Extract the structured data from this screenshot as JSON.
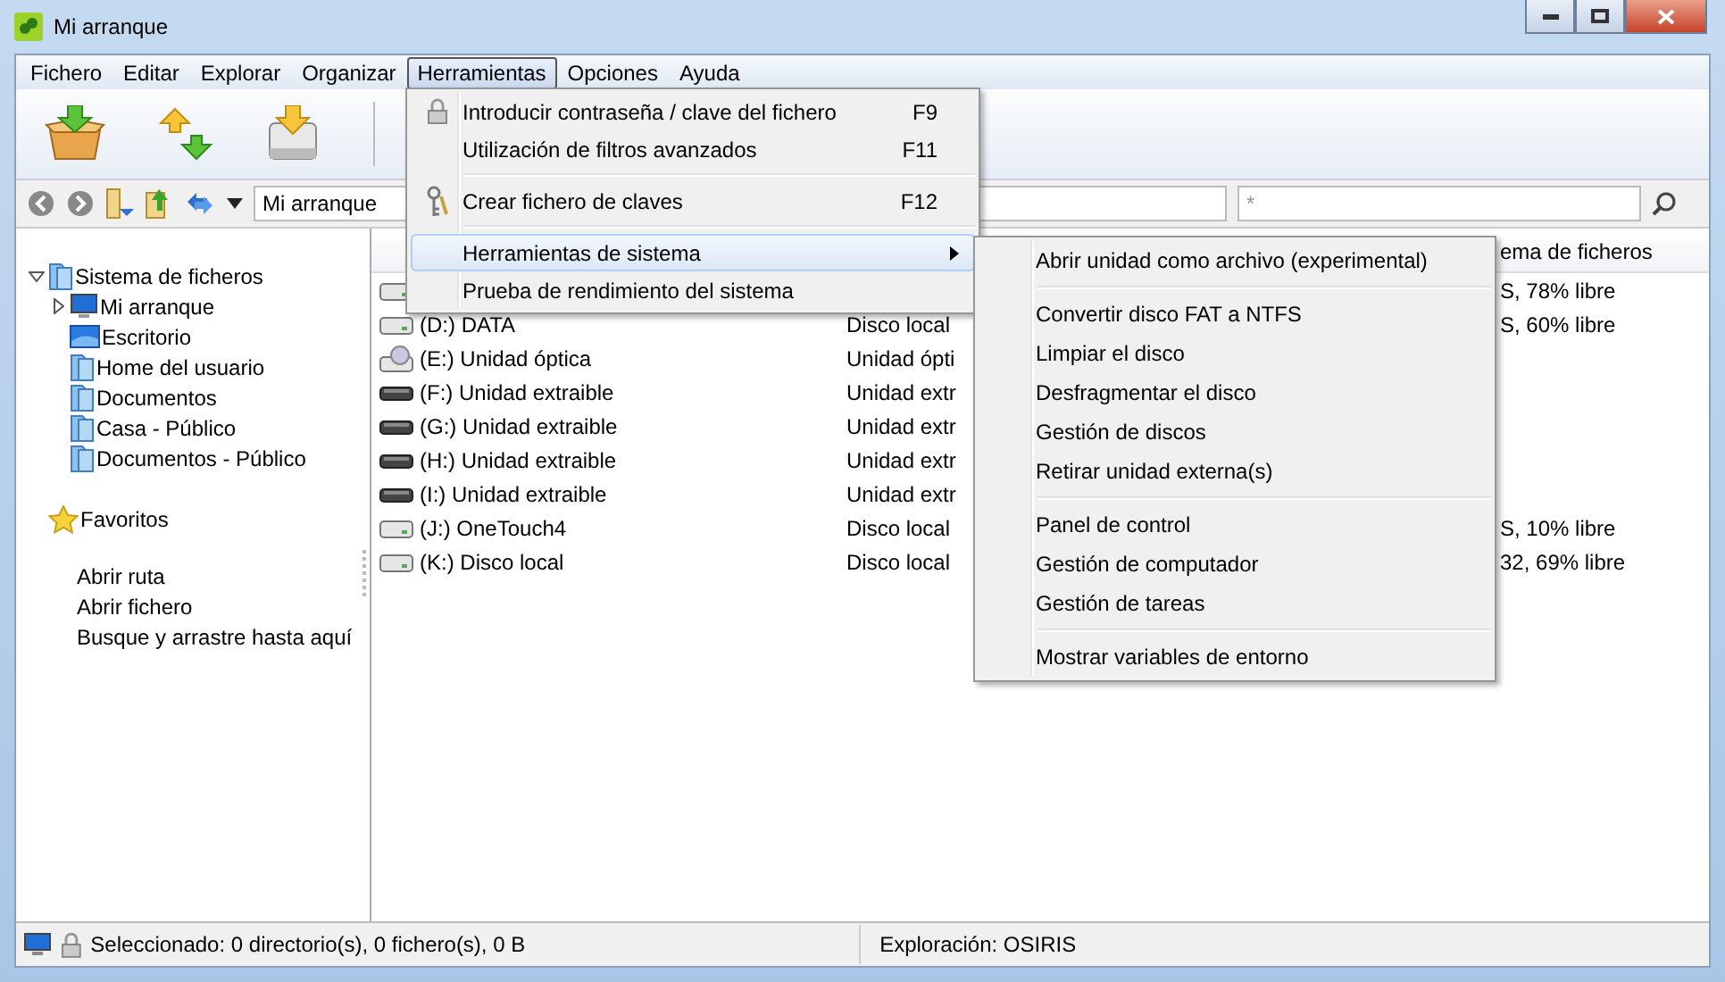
{
  "window": {
    "title": "Mi arranque"
  },
  "menu_bar": [
    {
      "label": "Fichero",
      "selected": false
    },
    {
      "label": "Editar",
      "selected": false
    },
    {
      "label": "Explorar",
      "selected": false
    },
    {
      "label": "Organizar",
      "selected": false
    },
    {
      "label": "Herramientas",
      "selected": true
    },
    {
      "label": "Opciones",
      "selected": false
    },
    {
      "label": "Ayuda",
      "selected": false
    }
  ],
  "address": {
    "value": "Mi arranque"
  },
  "search": {
    "placeholder": "*"
  },
  "tree": [
    {
      "label": "Sistema de ficheros",
      "kind": "folder",
      "expanded": true,
      "children": [
        {
          "label": "Mi arranque",
          "kind": "computer",
          "expanded": false
        },
        {
          "label": "Escritorio",
          "kind": "desktop"
        },
        {
          "label": "Home del usuario",
          "kind": "folder"
        },
        {
          "label": "Documentos",
          "kind": "folder"
        },
        {
          "label": "Casa - Público",
          "kind": "folder"
        },
        {
          "label": "Documentos - Público",
          "kind": "folder"
        }
      ]
    }
  ],
  "favorites": {
    "label": "Favoritos"
  },
  "links": [
    "Abrir ruta",
    "Abrir fichero",
    "Busque y arrastre hasta aquí"
  ],
  "file_list": {
    "column_3": "ema de ficheros",
    "rows": [
      {
        "kind": "disk",
        "filesystem": "S, 78% libre"
      },
      {
        "kind": "disk",
        "name": "(D:) DATA",
        "type": "Disco local",
        "filesystem": "S, 60% libre"
      },
      {
        "kind": "optical",
        "name": "(E:) Unidad óptica",
        "type": "Unidad ópti"
      },
      {
        "kind": "removable",
        "name": "(F:) Unidad extraible",
        "type": "Unidad extr"
      },
      {
        "kind": "removable",
        "name": "(G:) Unidad extraible",
        "type": "Unidad extr"
      },
      {
        "kind": "removable",
        "name": "(H:) Unidad extraible",
        "type": "Unidad extr"
      },
      {
        "kind": "removable",
        "name": "(I:) Unidad extraible",
        "type": "Unidad extr"
      },
      {
        "kind": "disk",
        "name": "(J:) OneTouch4",
        "type": "Disco local",
        "filesystem": "S, 10% libre"
      },
      {
        "kind": "disk",
        "name": "(K:) Disco local",
        "type": "Disco local",
        "filesystem": "32, 69% libre"
      }
    ]
  },
  "dropdown": {
    "items": [
      {
        "kind": "item",
        "label": "Introducir contraseña / clave del fichero",
        "shortcut": "F9",
        "highlighted": false
      },
      {
        "kind": "item",
        "label": "Utilización de filtros avanzados",
        "shortcut": "F11",
        "highlighted": false
      },
      {
        "kind": "separator"
      },
      {
        "kind": "item",
        "label": "Crear fichero de claves",
        "shortcut": "F12",
        "highlighted": false
      },
      {
        "kind": "separator"
      },
      {
        "kind": "submenu",
        "label": "Herramientas de sistema",
        "highlighted": true
      },
      {
        "kind": "item",
        "label": "Prueba de rendimiento del sistema",
        "highlighted": false
      }
    ]
  },
  "submenu": {
    "items": [
      {
        "kind": "item",
        "label": "Abrir unidad como archivo (experimental)"
      },
      {
        "kind": "separator"
      },
      {
        "kind": "item",
        "label": "Convertir disco FAT a NTFS"
      },
      {
        "kind": "item",
        "label": "Limpiar el disco"
      },
      {
        "kind": "item",
        "label": "Desfragmentar el disco"
      },
      {
        "kind": "item",
        "label": "Gestión de discos"
      },
      {
        "kind": "item",
        "label": "Retirar unidad externa(s)"
      },
      {
        "kind": "separator"
      },
      {
        "kind": "item",
        "label": "Panel de control"
      },
      {
        "kind": "item",
        "label": "Gestión de computador"
      },
      {
        "kind": "item",
        "label": "Gestión de tareas"
      },
      {
        "kind": "separator"
      },
      {
        "kind": "item",
        "label": "Mostrar variables de entorno"
      }
    ]
  },
  "status_bar": {
    "selection": "Seleccionado: 0 directorio(s), 0 fichero(s), 0 B",
    "exploration": "Exploración: OSIRIS"
  }
}
